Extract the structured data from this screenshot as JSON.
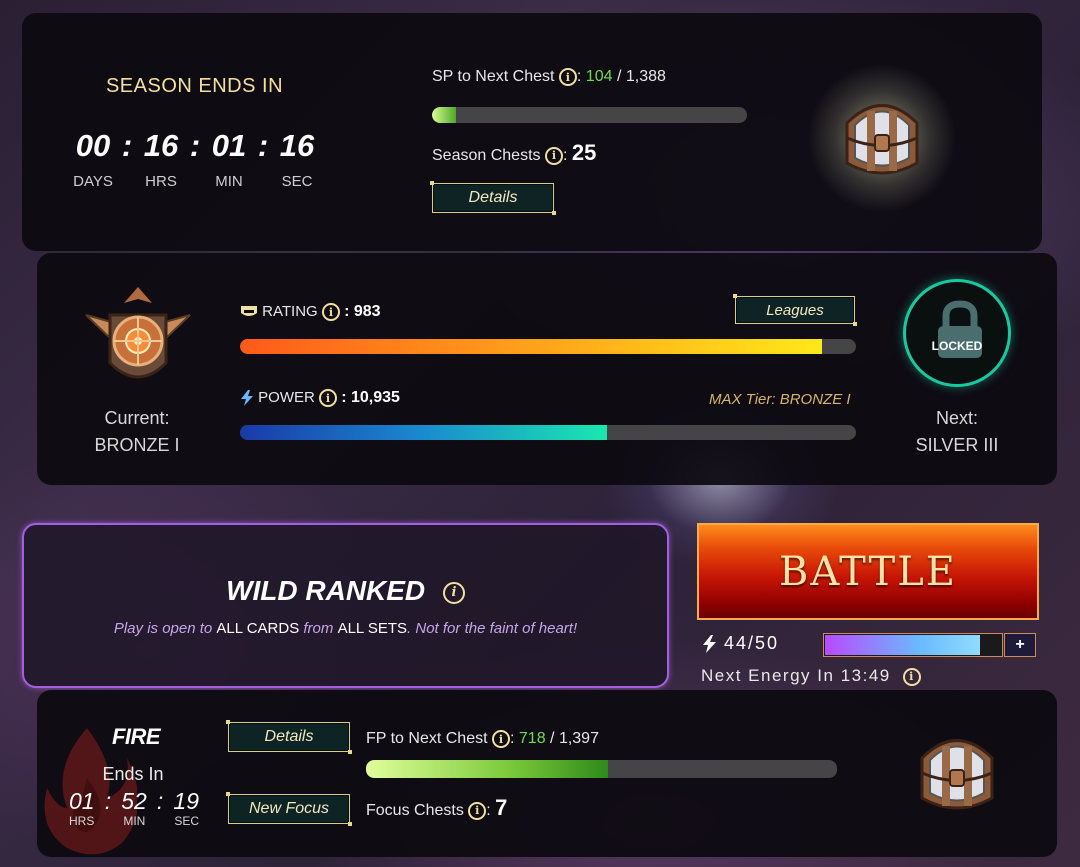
{
  "season": {
    "title": "SEASON ENDS IN",
    "days": "00",
    "hrs": "16",
    "min": "01",
    "sec": "16",
    "colon": ":",
    "labels": {
      "days": "DAYS",
      "hrs": "HRS",
      "min": "MIN",
      "sec": "SEC"
    },
    "sp_label": "SP to Next Chest",
    "sp_current": "104",
    "sp_total": "/ 1,388",
    "sp_progress": 0.075,
    "chests_label": "Season Chests",
    "chests_count": "25",
    "details_label": "Details"
  },
  "league": {
    "current_label": "Current:",
    "current_value": "BRONZE I",
    "rating_label": "RATING",
    "rating_value": ": 983",
    "rating_progress": 0.945,
    "leagues_button": "Leagues",
    "power_label": "POWER",
    "power_value": ": 10,935",
    "power_progress": 0.595,
    "max_tier": "MAX Tier: BRONZE I",
    "locked_label": "LOCKED",
    "next_label": "Next:",
    "next_value": "SILVER III"
  },
  "mode": {
    "title": "WILD RANKED",
    "desc_1": "Play is open to ",
    "desc_hl_1": "ALL CARDS",
    "desc_2": " from ",
    "desc_hl_2": "ALL SETS",
    "desc_3": ". Not for the faint of heart!"
  },
  "battle": {
    "label": "BATTLE",
    "energy_value": "44/50",
    "energy_progress": 0.88,
    "plus_label": "+",
    "next_energy_label": "Next Energy In",
    "next_energy_time": "13:49"
  },
  "focus": {
    "name": "FIRE",
    "ends_label": "Ends In",
    "hrs": "01",
    "min": "52",
    "sec": "19",
    "colon": ":",
    "labels": {
      "hrs": "HRS",
      "min": "MIN",
      "sec": "SEC"
    },
    "details_label": "Details",
    "new_focus_label": "New Focus",
    "fp_label": "FP to Next Chest",
    "fp_current": "718",
    "fp_total": "/ 1,397",
    "fp_progress": 0.514,
    "chests_label": "Focus Chests",
    "chests_count": "7"
  },
  "colors": {
    "accent_gold": "#f2e0a0",
    "progress_green": "#6fdc4c",
    "mode_border": "#a65ee0",
    "battle_red": "#c81606"
  },
  "icons": [
    "info-icon",
    "chest-icon",
    "rating-shield-icon",
    "power-bolt-icon",
    "padlock-icon",
    "bronze-league-badge",
    "energy-bolt-icon",
    "fire-flame-icon"
  ]
}
